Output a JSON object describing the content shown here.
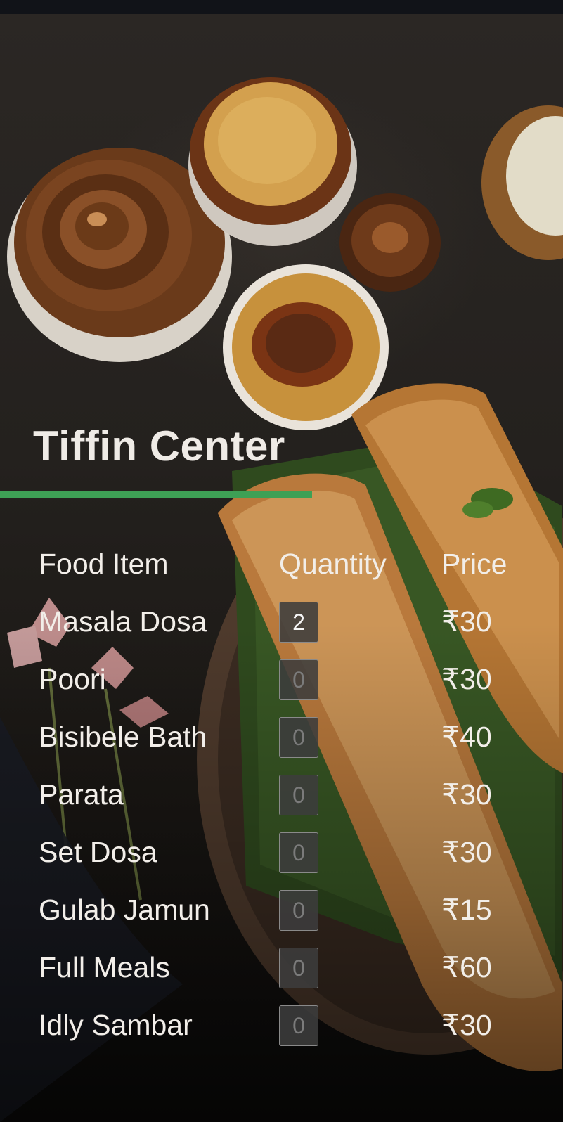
{
  "page": {
    "title": "Tiffin Center"
  },
  "colors": {
    "accent_underline": "#3ea055",
    "background": "#24211e",
    "text": "#f2eee9"
  },
  "menu": {
    "headers": {
      "item": "Food Item",
      "quantity": "Quantity",
      "price": "Price"
    },
    "items": [
      {
        "name": "Masala Dosa",
        "quantity": "2",
        "price": "₹30"
      },
      {
        "name": "Poori",
        "quantity": "0",
        "price": "₹30"
      },
      {
        "name": "Bisibele Bath",
        "quantity": "0",
        "price": "₹40"
      },
      {
        "name": "Parata",
        "quantity": "0",
        "price": "₹30"
      },
      {
        "name": "Set Dosa",
        "quantity": "0",
        "price": "₹30"
      },
      {
        "name": "Gulab Jamun",
        "quantity": "0",
        "price": "₹15"
      },
      {
        "name": "Full Meals",
        "quantity": "0",
        "price": "₹60"
      },
      {
        "name": "Idly Sambar",
        "quantity": "0",
        "price": "₹30"
      }
    ]
  }
}
